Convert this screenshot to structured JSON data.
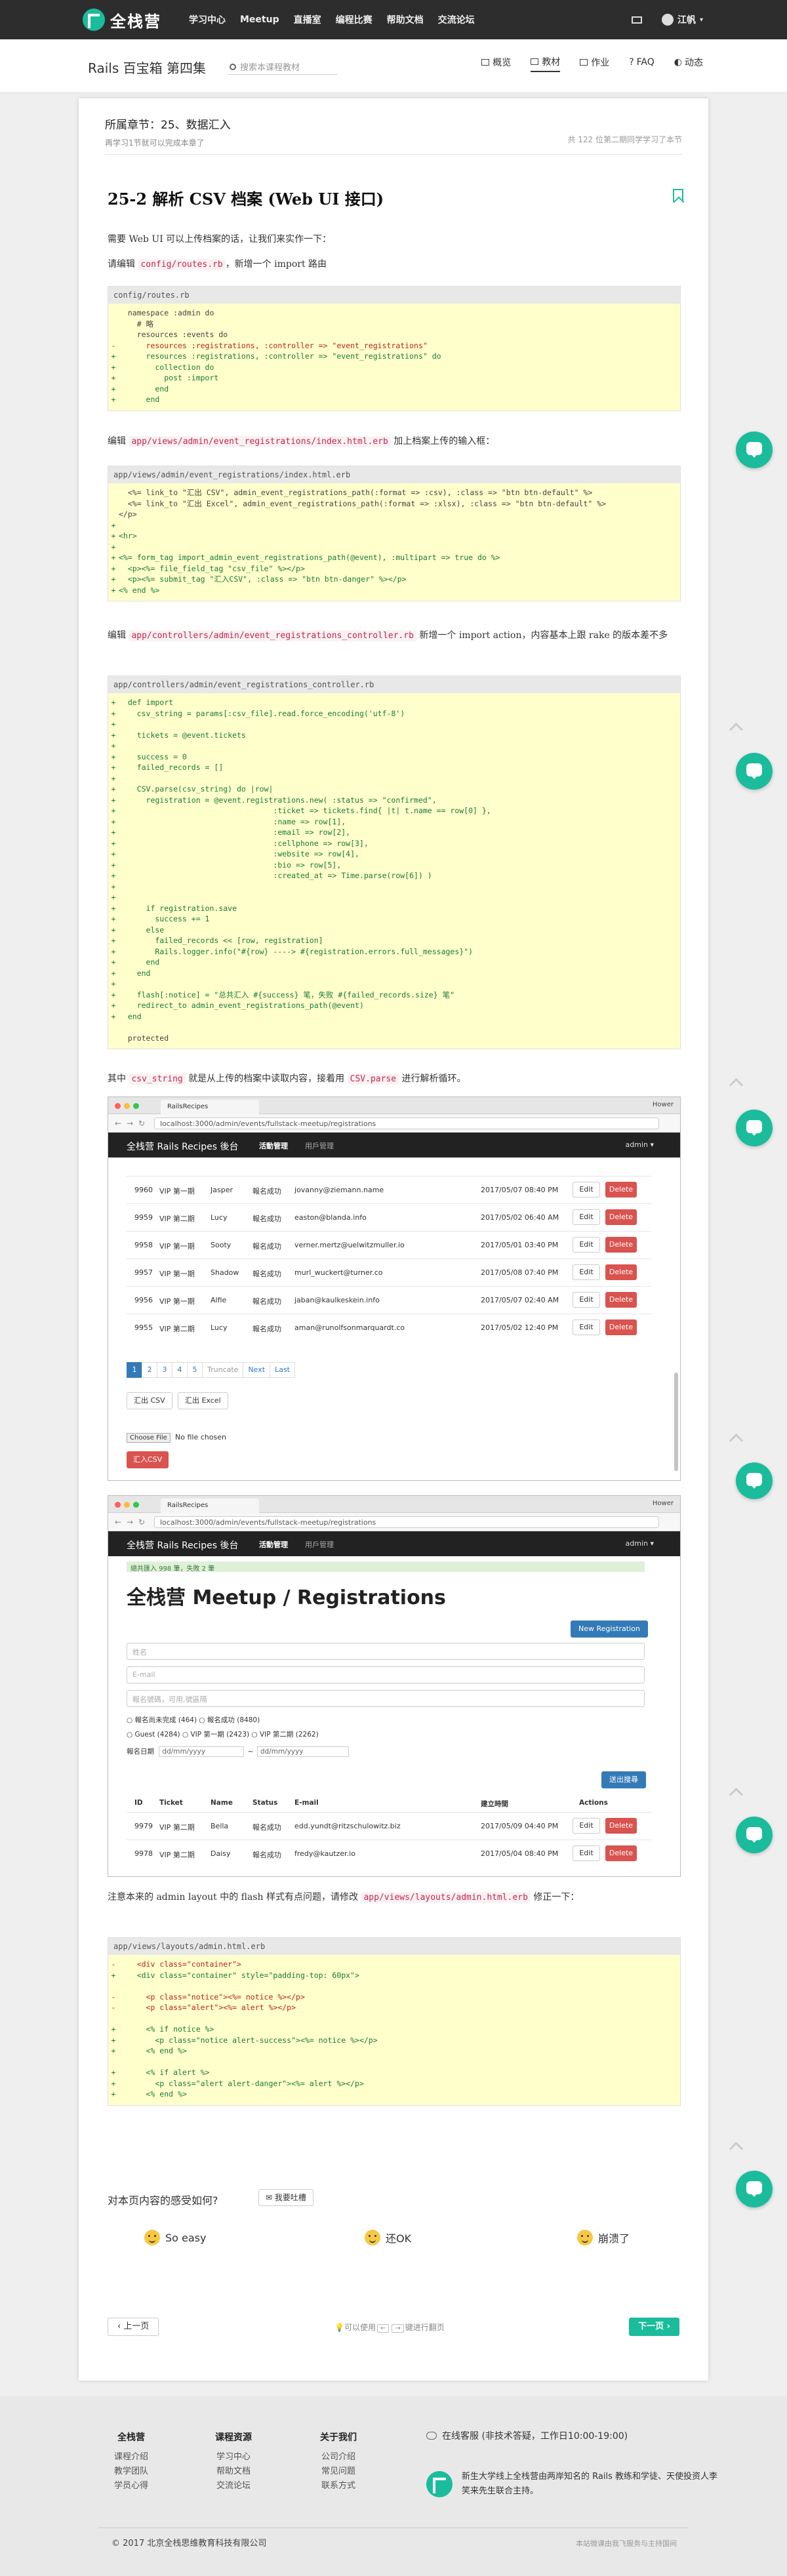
{
  "nav": {
    "logo_text": "全栈营",
    "menu": [
      "学习中心",
      "Meetup",
      "直播室",
      "编程比赛",
      "帮助文档",
      "交流论坛"
    ],
    "user": "江帆"
  },
  "subnav": {
    "book_title": "Rails 百宝箱 第四集",
    "search_placeholder": "搜索本课程教材",
    "tabs": [
      "概览",
      "教材",
      "作业",
      "FAQ",
      "动态"
    ]
  },
  "chapter": {
    "title": "所属章节：25、数据汇入",
    "note": "再学习1节就可以完成本章了",
    "stats": "共 122 位第二期同学学习了本节"
  },
  "lesson": {
    "title": "25-2 解析 CSV 档案 (Web UI 接口)",
    "intro": "需要 Web UI 可以上传档案的话，让我们来实作一下：",
    "p1_pre": "请编辑",
    "p1_code": "config/routes.rb",
    "p1_post": "，新增一个 import 路由",
    "p2_pre": "编辑",
    "p2_code": "app/views/admin/event_registrations/index.html.erb",
    "p2_post": "加上档案上传的输入框：",
    "p3_pre": "编辑",
    "p3_code": "app/controllers/admin/event_registrations_controller.rb",
    "p3_post": "新增一个 import action，内容基本上跟 rake 的版本差不多",
    "p4_a": "其中",
    "p4_code1": "csv_string",
    "p4_b": "就是从上传的档案中读取内容，接着用",
    "p4_code2": "CSV.parse",
    "p4_c": "进行解析循环。",
    "p5_pre": "注意本来的 admin layout 中的 flash 样式有点问题，请修改",
    "p5_code": "app/views/layouts/admin.html.erb",
    "p5_post": "修正一下："
  },
  "code1": {
    "file": "config/routes.rb",
    "lines": [
      {
        "t": " ",
        "c": "  namespace :admin do"
      },
      {
        "t": " ",
        "c": "    # 略"
      },
      {
        "t": " ",
        "c": "    resources :events do"
      },
      {
        "t": "-",
        "c": "      resources :registrations, :controller => \"event_registrations\""
      },
      {
        "t": "+",
        "c": "      resources :registrations, :controller => \"event_registrations\" do"
      },
      {
        "t": "+",
        "c": "        collection do"
      },
      {
        "t": "+",
        "c": "          post :import"
      },
      {
        "t": "+",
        "c": "        end"
      },
      {
        "t": "+",
        "c": "      end"
      }
    ]
  },
  "code2": {
    "file": "app/views/admin/event_registrations/index.html.erb",
    "lines": [
      {
        "t": " ",
        "c": "  <%= link_to \"汇出 CSV\", admin_event_registrations_path(:format => :csv), :class => \"btn btn-default\" %>"
      },
      {
        "t": " ",
        "c": "  <%= link_to \"汇出 Excel\", admin_event_registrations_path(:format => :xlsx), :class => \"btn btn-default\" %>"
      },
      {
        "t": " ",
        "c": "</p>"
      },
      {
        "t": "+",
        "c": ""
      },
      {
        "t": "+",
        "c": "<hr>"
      },
      {
        "t": "+",
        "c": ""
      },
      {
        "t": "+",
        "c": "<%= form_tag import_admin_event_registrations_path(@event), :multipart => true do %>"
      },
      {
        "t": "+",
        "c": "  <p><%= file_field_tag \"csv_file\" %></p>"
      },
      {
        "t": "+",
        "c": "  <p><%= submit_tag \"汇入CSV\", :class => \"btn btn-danger\" %></p>"
      },
      {
        "t": "+",
        "c": "<% end %>"
      }
    ]
  },
  "code3": {
    "file": "app/controllers/admin/event_registrations_controller.rb",
    "lines": [
      {
        "t": "+",
        "c": "  def import"
      },
      {
        "t": "+",
        "c": "    csv_string = params[:csv_file].read.force_encoding('utf-8')"
      },
      {
        "t": "+",
        "c": ""
      },
      {
        "t": "+",
        "c": "    tickets = @event.tickets"
      },
      {
        "t": "+",
        "c": ""
      },
      {
        "t": "+",
        "c": "    success = 0"
      },
      {
        "t": "+",
        "c": "    failed_records = []"
      },
      {
        "t": "+",
        "c": ""
      },
      {
        "t": "+",
        "c": "    CSV.parse(csv_string) do |row|"
      },
      {
        "t": "+",
        "c": "      registration = @event.registrations.new( :status => \"confirmed\","
      },
      {
        "t": "+",
        "c": "                                  :ticket => tickets.find{ |t| t.name == row[0] },"
      },
      {
        "t": "+",
        "c": "                                  :name => row[1],"
      },
      {
        "t": "+",
        "c": "                                  :email => row[2],"
      },
      {
        "t": "+",
        "c": "                                  :cellphone => row[3],"
      },
      {
        "t": "+",
        "c": "                                  :website => row[4],"
      },
      {
        "t": "+",
        "c": "                                  :bio => row[5],"
      },
      {
        "t": "+",
        "c": "                                  :created_at => Time.parse(row[6]) )"
      },
      {
        "t": "+",
        "c": ""
      },
      {
        "t": "+",
        "c": ""
      },
      {
        "t": "+",
        "c": "      if registration.save"
      },
      {
        "t": "+",
        "c": "        success += 1"
      },
      {
        "t": "+",
        "c": "      else"
      },
      {
        "t": "+",
        "c": "        failed_records << [row, registration]"
      },
      {
        "t": "+",
        "c": "        Rails.logger.info(\"#{row} ----> #{registration.errors.full_messages}\")"
      },
      {
        "t": "+",
        "c": "      end"
      },
      {
        "t": "+",
        "c": "    end"
      },
      {
        "t": "+",
        "c": ""
      },
      {
        "t": "+",
        "c": "    flash[:notice] = \"总共汇入 #{success} 笔，失败 #{failed_records.size} 笔\""
      },
      {
        "t": "+",
        "c": "    redirect_to admin_event_registrations_path(@event)"
      },
      {
        "t": "+",
        "c": "  end"
      },
      {
        "t": " ",
        "c": ""
      },
      {
        "t": " ",
        "c": "  protected"
      }
    ]
  },
  "code4": {
    "file": "app/views/layouts/admin.html.erb",
    "lines": [
      {
        "t": "-",
        "c": "    <div class=\"container\">"
      },
      {
        "t": "+",
        "c": "    <div class=\"container\" style=\"padding-top: 60px\">"
      },
      {
        "t": " ",
        "c": ""
      },
      {
        "t": "-",
        "c": "      <p class=\"notice\"><%= notice %></p>"
      },
      {
        "t": "-",
        "c": "      <p class=\"alert\"><%= alert %></p>"
      },
      {
        "t": " ",
        "c": ""
      },
      {
        "t": "+",
        "c": "      <% if notice %>"
      },
      {
        "t": "+",
        "c": "        <p class=\"notice alert-success\"><%= notice %></p>"
      },
      {
        "t": "+",
        "c": "      <% end %>"
      },
      {
        "t": " ",
        "c": ""
      },
      {
        "t": "+",
        "c": "      <% if alert %>"
      },
      {
        "t": "+",
        "c": "        <p class=\"alert alert-danger\"><%= alert %></p>"
      },
      {
        "t": "+",
        "c": "      <% end %>"
      }
    ]
  },
  "shot1": {
    "tab": "RailsRecipes",
    "user": "Hower",
    "url": "localhost:3000/admin/events/fullstack-meetup/registrations",
    "brand": "全栈营 Rails Recipes 後台",
    "menu1": "活動管理",
    "menu2": "用戶管理",
    "admin": "admin ▾",
    "rows": [
      {
        "id": "9960",
        "ticket": "VIP 第一期",
        "name": "Jasper",
        "status": "報名成功",
        "email": "jovanny@ziemann.name",
        "date": "2017/05/07 08:40 PM"
      },
      {
        "id": "9959",
        "ticket": "VIP 第二期",
        "name": "Lucy",
        "status": "報名成功",
        "email": "easton@blanda.info",
        "date": "2017/05/02 06:40 AM"
      },
      {
        "id": "9958",
        "ticket": "VIP 第一期",
        "name": "Sooty",
        "status": "報名成功",
        "email": "verner.mertz@uelwitzmuller.io",
        "date": "2017/05/01 03:40 PM"
      },
      {
        "id": "9957",
        "ticket": "VIP 第一期",
        "name": "Shadow",
        "status": "報名成功",
        "email": "murl_wuckert@turner.co",
        "date": "2017/05/08 07:40 PM"
      },
      {
        "id": "9956",
        "ticket": "VIP 第一期",
        "name": "Alfie",
        "status": "報名成功",
        "email": "jaban@kaulkeskein.info",
        "date": "2017/05/07 02:40 AM"
      },
      {
        "id": "9955",
        "ticket": "VIP 第二期",
        "name": "Lucy",
        "status": "報名成功",
        "email": "aman@runolfsonmarquardt.co",
        "date": "2017/05/02 12:40 PM"
      }
    ],
    "edit": "Edit",
    "delete": "Delete",
    "pages": [
      "1",
      "2",
      "3",
      "4",
      "5",
      "Truncate",
      "Next",
      "Last"
    ],
    "csv": "汇出 CSV",
    "excel": "汇出 Excel",
    "choose_file": "Choose File",
    "no_file": "No file chosen",
    "import": "汇入CSV"
  },
  "shot2": {
    "tab": "RailsRecipes",
    "user": "Hower",
    "url": "localhost:3000/admin/events/fullstack-meetup/registrations",
    "brand": "全栈营 Rails Recipes 後台",
    "menu1": "活動管理",
    "menu2": "用戶管理",
    "admin": "admin ▾",
    "flash": "總共匯入 998 筆，失敗 2 筆",
    "title": "全栈营 Meetup / Registrations",
    "new_btn": "New Registration",
    "ph_name": "姓名",
    "ph_email": "E-mail",
    "ph_phone": "報名號碼，可用,號區隔",
    "status_filter": "○ 報名尚未完成 (464)   ○ 報名成功 (8480)",
    "ticket_filter": "○ Guest (4284)   ○ VIP 第一期 (2423)   ○ VIP 第二期 (2262)",
    "date_label": "報名日期",
    "date_from": "dd/mm/yyyy",
    "date_sep": "~",
    "date_to": "dd/mm/yyyy",
    "filter_btn": "送出搜尋",
    "headers": [
      "ID",
      "Ticket",
      "Name",
      "Status",
      "E-mail",
      "建立時間",
      "Actions"
    ],
    "rows": [
      {
        "id": "9979",
        "ticket": "VIP 第二期",
        "name": "Bella",
        "status": "報名成功",
        "email": "edd.yundt@ritzschulowitz.biz",
        "date": "2017/05/09 04:40 PM"
      },
      {
        "id": "9978",
        "ticket": "VIP 第二期",
        "name": "Daisy",
        "status": "報名成功",
        "email": "fredy@kautzer.io",
        "date": "2017/05/04 08:40 PM"
      }
    ],
    "edit": "Edit",
    "delete": "Delete"
  },
  "feedback": {
    "question": "对本页内容的感受如何?",
    "suggest": "我要吐槽",
    "opt1": "So easy",
    "opt2": "还OK",
    "opt3": "崩溃了"
  },
  "pager": {
    "prev": "上一页",
    "next": "下一页",
    "tip_pre": "可以使用",
    "tip_post": "键进行翻页",
    "left_key": "←",
    "right_key": "→"
  },
  "footer": {
    "cols": [
      {
        "title": "全栈营",
        "items": [
          "课程介绍",
          "教学团队",
          "学员心得"
        ]
      },
      {
        "title": "课程资源",
        "items": [
          "学习中心",
          "帮助文档",
          "交流论坛"
        ]
      },
      {
        "title": "关于我们",
        "items": [
          "公司介绍",
          "常见问题",
          "联系方式"
        ]
      }
    ],
    "service": "在线客服 (非技术答疑，工作日10:00-19:00)",
    "about": "新生大学线上全栈营由两岸知名的 Rails 教练和学徒、天使投资人李笑来先生联合主持。",
    "copyright": "© 2017 北京全栈思维教育科技有限公司",
    "right_note": "本站微课由我飞服务与主持国间"
  }
}
